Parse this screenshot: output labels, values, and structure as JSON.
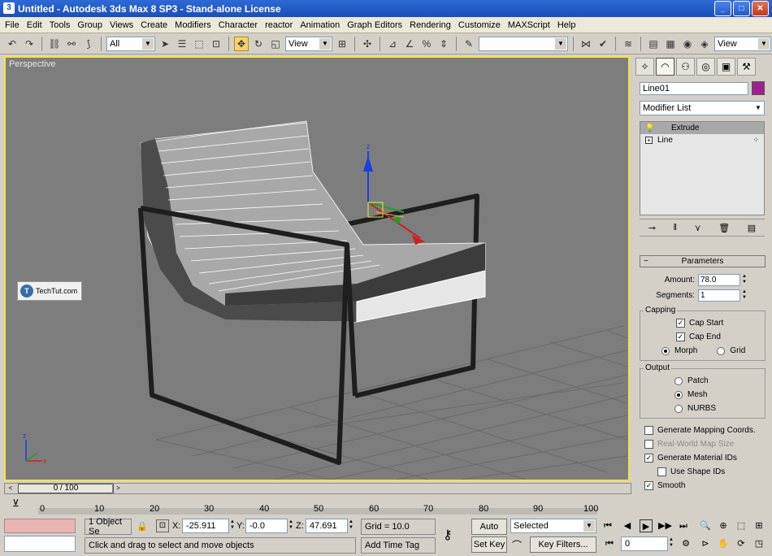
{
  "window": {
    "title": "Untitled  - Autodesk 3ds Max 8 SP3  - Stand-alone License",
    "app_icon": "3ds-max-icon",
    "buttons": [
      "minimize",
      "maximize",
      "close"
    ]
  },
  "menubar": {
    "items": [
      "File",
      "Edit",
      "Tools",
      "Group",
      "Views",
      "Create",
      "Modifiers",
      "Character",
      "reactor",
      "Animation",
      "Graph Editors",
      "Rendering",
      "Customize",
      "MAXScript",
      "Help"
    ]
  },
  "toolbar": {
    "selection_filter": "All",
    "ref_coord": "View",
    "named_selection": "",
    "viewport_view": "View"
  },
  "viewport": {
    "label": "Perspective",
    "watermark_text": "TechTut.com",
    "watermark_logo": "T",
    "gizmo_axes": [
      "x",
      "y",
      "z"
    ],
    "corner_axes": [
      "x",
      "y",
      "z"
    ]
  },
  "command_panel": {
    "object_name": "Line01",
    "object_color": "#a02090",
    "modifier_list_label": "Modifier List",
    "stack": [
      {
        "label": "Extrude",
        "selected": true
      },
      {
        "label": "Line",
        "selected": false
      }
    ],
    "rollout_title": "Parameters",
    "amount_label": "Amount:",
    "amount_value": "78.0",
    "segments_label": "Segments:",
    "segments_value": "1",
    "capping": {
      "label": "Capping",
      "cap_start": "Cap Start",
      "cap_end": "Cap End",
      "morph": "Morph",
      "grid": "Grid"
    },
    "output": {
      "label": "Output",
      "patch": "Patch",
      "mesh": "Mesh",
      "nurbs": "NURBS"
    },
    "options": {
      "gen_mapping": "Generate Mapping Coords.",
      "real_world": "Real-World Map Size",
      "gen_matids": "Generate Material IDs",
      "use_shape_ids": "Use Shape IDs",
      "smooth": "Smooth"
    }
  },
  "timeline": {
    "frame_display": "0 / 100",
    "ticks": [
      "0",
      "10",
      "20",
      "30",
      "40",
      "50",
      "60",
      "70",
      "80",
      "90",
      "100"
    ]
  },
  "status": {
    "selection_info": "1 Object Se",
    "prompt": "Click and drag to select and move objects",
    "x_label": "X:",
    "x_value": "-25.911",
    "y_label": "Y:",
    "y_value": "-0.0",
    "z_label": "Z:",
    "z_value": "47.691",
    "grid": "Grid = 10.0",
    "add_time_tag": "Add Time Tag",
    "auto_key": "Auto Key",
    "set_key": "Set Key",
    "key_mode": "Selected",
    "key_filters": "Key Filters...",
    "current_frame": "0"
  }
}
